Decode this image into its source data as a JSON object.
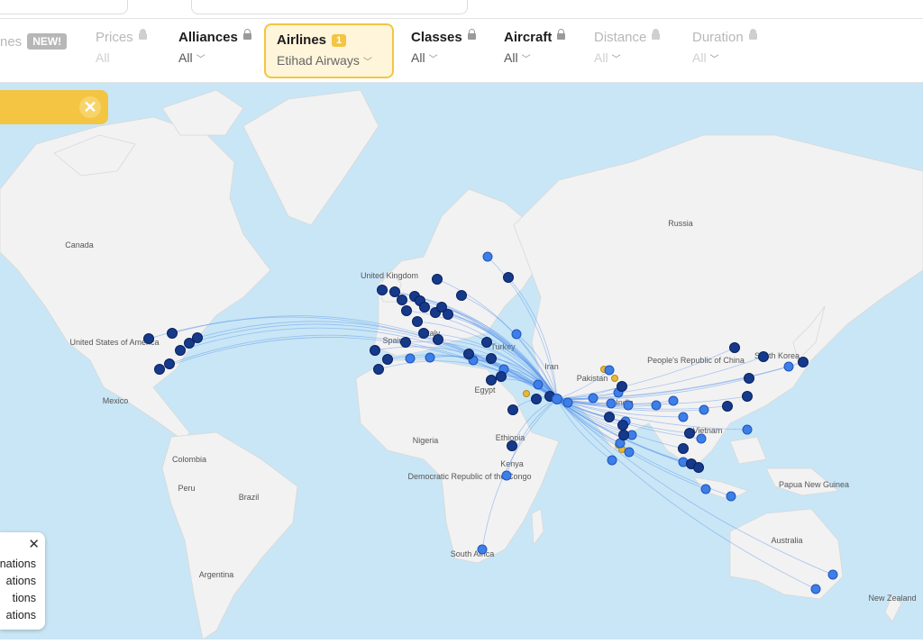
{
  "filters": {
    "partial_first": {
      "label": "nes",
      "badge": "NEW!"
    },
    "prices": {
      "label": "Prices",
      "value": "All"
    },
    "alliances": {
      "label": "Alliances",
      "value": "All"
    },
    "airlines": {
      "label": "Airlines",
      "count": "1",
      "value": "Etihad Airways"
    },
    "classes": {
      "label": "Classes",
      "value": "All"
    },
    "aircraft": {
      "label": "Aircraft",
      "value": "All"
    },
    "distance": {
      "label": "Distance",
      "value": "All"
    },
    "duration": {
      "label": "Duration",
      "value": "All"
    }
  },
  "banner": {
    "close": "✕"
  },
  "legend": {
    "close": "✕",
    "rows": [
      "nations",
      "ations",
      "tions",
      "ations"
    ]
  },
  "map": {
    "labels": [
      "Canada",
      "United States of America",
      "Mexico",
      "Colombia",
      "Peru",
      "Brazil",
      "Argentina",
      "Nigeria",
      "Democratic Republic of the Congo",
      "Kenya",
      "Ethiopia",
      "Egypt",
      "South Africa",
      "Russia",
      "People's Republic of China",
      "Vietnam",
      "India",
      "Pakistan",
      "Iran",
      "Turkey",
      "Italy",
      "Spain",
      "United Kingdom",
      "South Korea",
      "Papua New Guinea",
      "Australia",
      "New Zealand"
    ],
    "colors": {
      "land": "#f2f2f2",
      "water": "#c9e6f6",
      "route": "#4d8be8",
      "dot_dark": "#153a8a",
      "dot_light": "#3d7ee8",
      "dot_yellow": "#e8b838",
      "hub": "Abu Dhabi"
    }
  }
}
